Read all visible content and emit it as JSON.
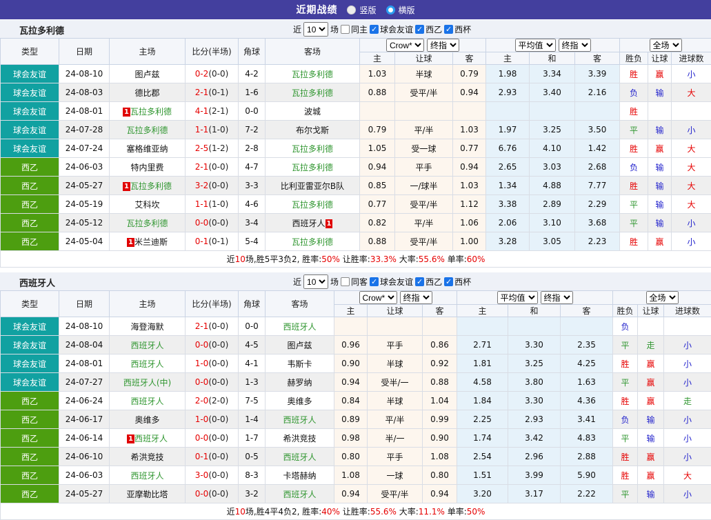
{
  "topbar": {
    "title": "近期战绩",
    "radio_vertical": "竖版",
    "radio_horizontal": "横版",
    "selected": "横版"
  },
  "colors": {
    "topbar_bg": "#433f9e",
    "friendly_teal": "#11a1a1",
    "league_green": "#4d9e10",
    "team_green": "#309630",
    "result_red": "#e60000",
    "result_blue": "#2222cc",
    "card_red": "#e00000",
    "checkbox_blue": "#1a73e8",
    "crow_col_bg": "#fdf6ee",
    "avg_col_bg": "#e6f2fa"
  },
  "columns": {
    "type": "类型",
    "date": "日期",
    "home": "主场",
    "score": "比分(半场)",
    "corner": "角球",
    "away": "客场",
    "sub": [
      "主",
      "让球",
      "客",
      "主",
      "和",
      "客",
      "胜负",
      "让球",
      "进球数"
    ],
    "select_crow": "Crow*",
    "select_final1": "终指",
    "select_avg": "平均值",
    "select_final2": "终指",
    "select_full": "全场"
  },
  "sections": [
    {
      "team": "瓦拉多利德",
      "filter": {
        "near_label": "近",
        "count": "10",
        "games_label": "场",
        "same_label": "同主",
        "same_checked": false,
        "leagues": [
          {
            "label": "球会友谊",
            "checked": true
          },
          {
            "label": "西乙",
            "checked": true
          },
          {
            "label": "西杯",
            "checked": true
          }
        ]
      },
      "rows": [
        {
          "type": "球会友谊",
          "type_color": "teal",
          "date": "24-08-10",
          "home": {
            "name": "图卢兹",
            "green": false
          },
          "score": "0-2",
          "half": "(0-0)",
          "corner": "4-2",
          "away": {
            "name": "瓦拉多利德",
            "green": true
          },
          "crow": [
            "1.03",
            "半球",
            "0.79"
          ],
          "avg": [
            "1.98",
            "3.34",
            "3.39"
          ],
          "res": [
            "胜",
            "r"
          ],
          "let": [
            "赢",
            "r"
          ],
          "goal": [
            "小",
            "b"
          ],
          "shade": false
        },
        {
          "type": "球会友谊",
          "type_color": "teal",
          "date": "24-08-03",
          "home": {
            "name": "德比郡",
            "green": false
          },
          "score": "2-1",
          "half": "(0-1)",
          "corner": "1-6",
          "away": {
            "name": "瓦拉多利德",
            "green": true
          },
          "crow": [
            "0.88",
            "受平/半",
            "0.94"
          ],
          "avg": [
            "2.93",
            "3.40",
            "2.16"
          ],
          "res": [
            "负",
            "b"
          ],
          "let": [
            "输",
            "b"
          ],
          "goal": [
            "大",
            "r"
          ],
          "shade": true
        },
        {
          "type": "球会友谊",
          "type_color": "teal",
          "date": "24-08-01",
          "home": {
            "name": "瓦拉多利德",
            "green": true,
            "card_pre": "1"
          },
          "score": "4-1",
          "half": "(2-1)",
          "corner": "0-0",
          "away": {
            "name": "波城",
            "green": false
          },
          "crow": [
            "",
            "",
            ""
          ],
          "avg": [
            "",
            "",
            ""
          ],
          "res": [
            "胜",
            "r"
          ],
          "let": [
            "",
            ""
          ],
          "goal": [
            "",
            ""
          ],
          "shade": false
        },
        {
          "type": "球会友谊",
          "type_color": "teal",
          "date": "24-07-28",
          "home": {
            "name": "瓦拉多利德",
            "green": true
          },
          "score": "1-1",
          "half": "(1-0)",
          "corner": "7-2",
          "away": {
            "name": "布尔戈斯",
            "green": false
          },
          "crow": [
            "0.79",
            "平/半",
            "1.03"
          ],
          "avg": [
            "1.97",
            "3.25",
            "3.50"
          ],
          "res": [
            "平",
            "g"
          ],
          "let": [
            "输",
            "b"
          ],
          "goal": [
            "小",
            "b"
          ],
          "shade": true
        },
        {
          "type": "球会友谊",
          "type_color": "teal",
          "date": "24-07-24",
          "home": {
            "name": "塞格维亚纳",
            "green": false
          },
          "score": "2-5",
          "half": "(1-2)",
          "corner": "2-8",
          "away": {
            "name": "瓦拉多利德",
            "green": true
          },
          "crow": [
            "1.05",
            "受一球",
            "0.77"
          ],
          "avg": [
            "6.76",
            "4.10",
            "1.42"
          ],
          "res": [
            "胜",
            "r"
          ],
          "let": [
            "赢",
            "r"
          ],
          "goal": [
            "大",
            "r"
          ],
          "shade": false
        },
        {
          "type": "西乙",
          "type_color": "green",
          "date": "24-06-03",
          "home": {
            "name": "特内里费",
            "green": false
          },
          "score": "2-1",
          "half": "(0-0)",
          "corner": "4-7",
          "away": {
            "name": "瓦拉多利德",
            "green": true
          },
          "crow": [
            "0.94",
            "平手",
            "0.94"
          ],
          "avg": [
            "2.65",
            "3.03",
            "2.68"
          ],
          "res": [
            "负",
            "b"
          ],
          "let": [
            "输",
            "b"
          ],
          "goal": [
            "大",
            "r"
          ],
          "shade": false
        },
        {
          "type": "西乙",
          "type_color": "green",
          "date": "24-05-27",
          "home": {
            "name": "瓦拉多利德",
            "green": true,
            "card_pre": "1"
          },
          "score": "3-2",
          "half": "(0-0)",
          "corner": "3-3",
          "away": {
            "name": "比利亚雷亚尔B队",
            "green": false
          },
          "crow": [
            "0.85",
            "一/球半",
            "1.03"
          ],
          "avg": [
            "1.34",
            "4.88",
            "7.77"
          ],
          "res": [
            "胜",
            "r"
          ],
          "let": [
            "输",
            "b"
          ],
          "goal": [
            "大",
            "r"
          ],
          "shade": true
        },
        {
          "type": "西乙",
          "type_color": "green",
          "date": "24-05-19",
          "home": {
            "name": "艾科坎",
            "green": false
          },
          "score": "1-1",
          "half": "(1-0)",
          "corner": "4-6",
          "away": {
            "name": "瓦拉多利德",
            "green": true
          },
          "crow": [
            "0.77",
            "受平/半",
            "1.12"
          ],
          "avg": [
            "3.38",
            "2.89",
            "2.29"
          ],
          "res": [
            "平",
            "g"
          ],
          "let": [
            "输",
            "b"
          ],
          "goal": [
            "大",
            "r"
          ],
          "shade": false
        },
        {
          "type": "西乙",
          "type_color": "green",
          "date": "24-05-12",
          "home": {
            "name": "瓦拉多利德",
            "green": true
          },
          "score": "0-0",
          "half": "(0-0)",
          "corner": "3-4",
          "away": {
            "name": "西班牙人",
            "green": false,
            "card_post": "1"
          },
          "crow": [
            "0.82",
            "平/半",
            "1.06"
          ],
          "avg": [
            "2.06",
            "3.10",
            "3.68"
          ],
          "res": [
            "平",
            "g"
          ],
          "let": [
            "输",
            "b"
          ],
          "goal": [
            "小",
            "b"
          ],
          "shade": true
        },
        {
          "type": "西乙",
          "type_color": "green",
          "date": "24-05-04",
          "home": {
            "name": "米兰迪斯",
            "green": false,
            "card_pre": "1"
          },
          "score": "0-1",
          "half": "(0-1)",
          "corner": "5-4",
          "away": {
            "name": "瓦拉多利德",
            "green": true
          },
          "crow": [
            "0.88",
            "受平/半",
            "1.00"
          ],
          "avg": [
            "3.28",
            "3.05",
            "2.23"
          ],
          "res": [
            "胜",
            "r"
          ],
          "let": [
            "赢",
            "r"
          ],
          "goal": [
            "小",
            "b"
          ],
          "shade": false
        }
      ],
      "summary_parts": [
        [
          "近",
          0
        ],
        [
          "10",
          1
        ],
        [
          "场,胜5平3负2, 胜率:",
          0
        ],
        [
          "50%",
          1
        ],
        [
          " 让胜率:",
          0
        ],
        [
          "33.3%",
          1
        ],
        [
          " 大率:",
          0
        ],
        [
          "55.6%",
          1
        ],
        [
          " 单率:",
          0
        ],
        [
          "60%",
          1
        ]
      ]
    },
    {
      "team": "西班牙人",
      "filter": {
        "near_label": "近",
        "count": "10",
        "games_label": "场",
        "same_label": "同客",
        "same_checked": false,
        "leagues": [
          {
            "label": "球会友谊",
            "checked": true
          },
          {
            "label": "西乙",
            "checked": true
          },
          {
            "label": "西杯",
            "checked": true
          }
        ]
      },
      "rows": [
        {
          "type": "球会友谊",
          "type_color": "teal",
          "date": "24-08-10",
          "home": {
            "name": "海登海默",
            "green": false
          },
          "score": "2-1",
          "half": "(0-0)",
          "corner": "0-0",
          "away": {
            "name": "西班牙人",
            "green": true
          },
          "crow": [
            "",
            "",
            ""
          ],
          "avg": [
            "",
            "",
            ""
          ],
          "res": [
            "负",
            "b"
          ],
          "let": [
            "",
            ""
          ],
          "goal": [
            "",
            ""
          ],
          "shade": false
        },
        {
          "type": "球会友谊",
          "type_color": "teal",
          "date": "24-08-04",
          "home": {
            "name": "西班牙人",
            "green": true
          },
          "score": "0-0",
          "half": "(0-0)",
          "corner": "4-5",
          "away": {
            "name": "图卢兹",
            "green": false
          },
          "crow": [
            "0.96",
            "平手",
            "0.86"
          ],
          "avg": [
            "2.71",
            "3.30",
            "2.35"
          ],
          "res": [
            "平",
            "g"
          ],
          "let": [
            "走",
            "g"
          ],
          "goal": [
            "小",
            "b"
          ],
          "shade": true
        },
        {
          "type": "球会友谊",
          "type_color": "teal",
          "date": "24-08-01",
          "home": {
            "name": "西班牙人",
            "green": true
          },
          "score": "1-0",
          "half": "(0-0)",
          "corner": "4-1",
          "away": {
            "name": "韦斯卡",
            "green": false
          },
          "crow": [
            "0.90",
            "半球",
            "0.92"
          ],
          "avg": [
            "1.81",
            "3.25",
            "4.25"
          ],
          "res": [
            "胜",
            "r"
          ],
          "let": [
            "赢",
            "r"
          ],
          "goal": [
            "小",
            "b"
          ],
          "shade": false
        },
        {
          "type": "球会友谊",
          "type_color": "teal",
          "date": "24-07-27",
          "home": {
            "name": "西班牙人(中)",
            "green": true
          },
          "score": "0-0",
          "half": "(0-0)",
          "corner": "1-3",
          "away": {
            "name": "赫罗纳",
            "green": false
          },
          "crow": [
            "0.94",
            "受半/一",
            "0.88"
          ],
          "avg": [
            "4.58",
            "3.80",
            "1.63"
          ],
          "res": [
            "平",
            "g"
          ],
          "let": [
            "赢",
            "r"
          ],
          "goal": [
            "小",
            "b"
          ],
          "shade": true
        },
        {
          "type": "西乙",
          "type_color": "green",
          "date": "24-06-24",
          "home": {
            "name": "西班牙人",
            "green": true
          },
          "score": "2-0",
          "half": "(2-0)",
          "corner": "7-5",
          "away": {
            "name": "奥维多",
            "green": false
          },
          "crow": [
            "0.84",
            "半球",
            "1.04"
          ],
          "avg": [
            "1.84",
            "3.30",
            "4.36"
          ],
          "res": [
            "胜",
            "r"
          ],
          "let": [
            "赢",
            "r"
          ],
          "goal": [
            "走",
            "g"
          ],
          "shade": false
        },
        {
          "type": "西乙",
          "type_color": "green",
          "date": "24-06-17",
          "home": {
            "name": "奥维多",
            "green": false
          },
          "score": "1-0",
          "half": "(0-0)",
          "corner": "1-4",
          "away": {
            "name": "西班牙人",
            "green": true
          },
          "crow": [
            "0.89",
            "平/半",
            "0.99"
          ],
          "avg": [
            "2.25",
            "2.93",
            "3.41"
          ],
          "res": [
            "负",
            "b"
          ],
          "let": [
            "输",
            "b"
          ],
          "goal": [
            "小",
            "b"
          ],
          "shade": true
        },
        {
          "type": "西乙",
          "type_color": "green",
          "date": "24-06-14",
          "home": {
            "name": "西班牙人",
            "green": true,
            "card_pre": "1"
          },
          "score": "0-0",
          "half": "(0-0)",
          "corner": "1-7",
          "away": {
            "name": "希洪竞技",
            "green": false
          },
          "crow": [
            "0.98",
            "半/一",
            "0.90"
          ],
          "avg": [
            "1.74",
            "3.42",
            "4.83"
          ],
          "res": [
            "平",
            "g"
          ],
          "let": [
            "输",
            "b"
          ],
          "goal": [
            "小",
            "b"
          ],
          "shade": false
        },
        {
          "type": "西乙",
          "type_color": "green",
          "date": "24-06-10",
          "home": {
            "name": "希洪竞技",
            "green": false
          },
          "score": "0-1",
          "half": "(0-0)",
          "corner": "0-5",
          "away": {
            "name": "西班牙人",
            "green": true
          },
          "crow": [
            "0.80",
            "平手",
            "1.08"
          ],
          "avg": [
            "2.54",
            "2.96",
            "2.88"
          ],
          "res": [
            "胜",
            "r"
          ],
          "let": [
            "赢",
            "r"
          ],
          "goal": [
            "小",
            "b"
          ],
          "shade": true
        },
        {
          "type": "西乙",
          "type_color": "green",
          "date": "24-06-03",
          "home": {
            "name": "西班牙人",
            "green": true
          },
          "score": "3-0",
          "half": "(0-0)",
          "corner": "8-3",
          "away": {
            "name": "卡塔赫纳",
            "green": false
          },
          "crow": [
            "1.08",
            "一球",
            "0.80"
          ],
          "avg": [
            "1.51",
            "3.99",
            "5.90"
          ],
          "res": [
            "胜",
            "r"
          ],
          "let": [
            "赢",
            "r"
          ],
          "goal": [
            "大",
            "r"
          ],
          "shade": false
        },
        {
          "type": "西乙",
          "type_color": "green",
          "date": "24-05-27",
          "home": {
            "name": "亚摩勒比塔",
            "green": false
          },
          "score": "0-0",
          "half": "(0-0)",
          "corner": "3-2",
          "away": {
            "name": "西班牙人",
            "green": true
          },
          "crow": [
            "0.94",
            "受平/半",
            "0.94"
          ],
          "avg": [
            "3.20",
            "3.17",
            "2.22"
          ],
          "res": [
            "平",
            "g"
          ],
          "let": [
            "输",
            "b"
          ],
          "goal": [
            "小",
            "b"
          ],
          "shade": true
        }
      ],
      "summary_parts": [
        [
          "近",
          0
        ],
        [
          "10",
          1
        ],
        [
          "场,胜4平4负2, 胜率:",
          0
        ],
        [
          "40%",
          1
        ],
        [
          " 让胜率:",
          0
        ],
        [
          "55.6%",
          1
        ],
        [
          " 大率:",
          0
        ],
        [
          "11.1%",
          1
        ],
        [
          " 单率:",
          0
        ],
        [
          "50%",
          1
        ]
      ]
    }
  ]
}
